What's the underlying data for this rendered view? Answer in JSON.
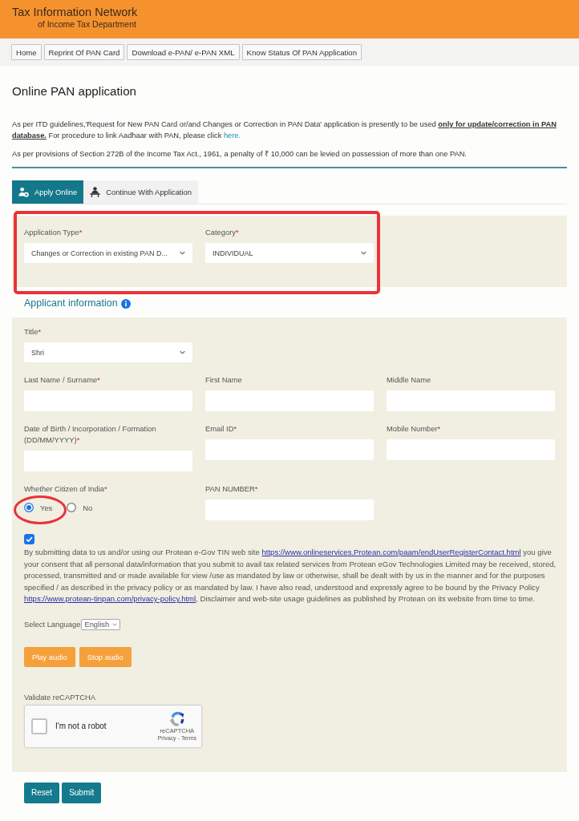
{
  "header": {
    "title": "Tax Information Network",
    "subtitle": "of Income Tax Department"
  },
  "nav": [
    "Home",
    "Reprint Of PAN Card",
    "Download e-PAN/ e-PAN XML",
    "Know Status Of PAN Application"
  ],
  "page_title": "Online PAN application",
  "notices": [
    {
      "text": "As per ITD guidelines,'Request for New PAN Card or/and Changes or Correction in PAN Data' application is presently to be used **only for update/correction in PAN database.** For procedure to link Aadhaar with PAN, please click ",
      "link": "here."
    },
    {
      "text": "As per provisions of Section 272B of the Income Tax Act., 1961, a penalty of ₹ 10,000 can be levied on possession of more than one PAN."
    }
  ],
  "tabs": [
    {
      "label": "Apply Online",
      "selected": true
    },
    {
      "label": "Continue With Application",
      "selected": false
    }
  ],
  "application": {
    "highlighted": true,
    "fields": [
      {
        "label": "Application Type",
        "required_mark": "*",
        "kind": "select",
        "value": "Changes or Correction in existing PAN D..."
      },
      {
        "label": "Category",
        "required_mark": "*",
        "kind": "select",
        "value": "INDIVIDUAL"
      }
    ]
  },
  "applicant": {
    "heading": "Applicant information",
    "rows": [
      [
        {
          "label": "Title",
          "required_mark": "*",
          "kind": "select",
          "value": "Shri"
        }
      ],
      [
        {
          "label": "Last Name / Surname",
          "required_mark": "*",
          "kind": "text"
        },
        {
          "label": "First Name",
          "kind": "text"
        },
        {
          "label": "Middle Name",
          "kind": "text"
        }
      ],
      [
        {
          "label": "Date of Birth / Incorporation / Formation (DD/MM/YYYY)",
          "required_mark": "*",
          "kind": "text"
        },
        {
          "label": "Email ID",
          "required_mark": "*",
          "kind": "text"
        },
        {
          "label": "Mobile Number",
          "required_mark": "*",
          "kind": "text"
        }
      ],
      [
        {
          "label": "Whether Citizen of India",
          "required_mark": "*",
          "kind": "radio",
          "highlighted": true,
          "options": [
            {
              "label": "Yes",
              "selected": true
            },
            {
              "label": "No",
              "selected": false
            }
          ]
        },
        {
          "label": "PAN NUMBER",
          "required_mark": "*",
          "kind": "text"
        }
      ]
    ],
    "consent": {
      "checked": true,
      "segments": [
        {
          "kind": "text",
          "text": "By submitting data to us and/or using our Protean e-Gov TIN web site "
        },
        {
          "kind": "link",
          "text": "https://www.onlineservices.Protean.com/paam/endUserRegisterContact.html"
        },
        {
          "kind": "text",
          "text": " you give your consent that all personal data/information that you submit to avail tax related services from Protean eGov Technologies Limited may be received, stored, processed, transmitted and or made available for view /use as mandated by law or otherwise, shall be dealt with by us in the manner and for the purposes specified / as described in the privacy policy or as mandated by law. I have also read, understood and expressly agree to be bound by the Privacy Policy "
        },
        {
          "kind": "link",
          "text": "https://www.protean-tinpan.com/privacy-policy.html"
        },
        {
          "kind": "text",
          "text": ", Disclaimer and web-site usage guidelines as published by Protean on its website from time to time."
        }
      ]
    },
    "language": {
      "label": "Select Language",
      "value": "English"
    },
    "audio_buttons": [
      "Play audio",
      "Stop audio"
    ],
    "captcha": {
      "label": "Validate reCAPTCHA",
      "checked": false,
      "text": "I'm not a robot",
      "brand": "reCAPTCHA",
      "links": [
        "Privacy",
        "Terms"
      ],
      "separator": "-"
    }
  },
  "buttons": [
    "Reset",
    "Submit"
  ]
}
